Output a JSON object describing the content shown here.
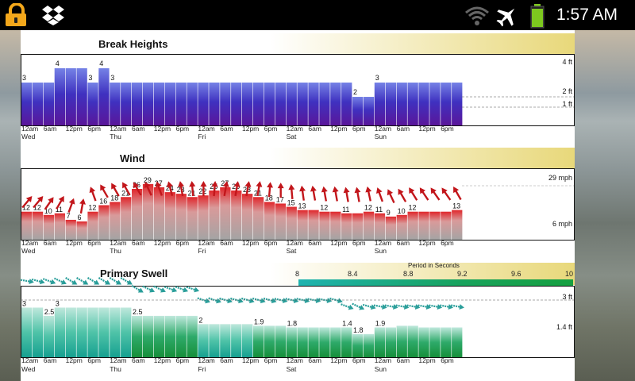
{
  "status_bar": {
    "time": "1:57 AM",
    "icons": [
      "lock-icon",
      "dropbox-icon",
      "wifi-icon",
      "airplane-icon",
      "battery-icon"
    ],
    "colors": {
      "background": "#000000",
      "lock": "#f3a71b",
      "battery": "#7dc81f"
    }
  },
  "sections": {
    "break_heights": {
      "title": "Break Heights"
    },
    "wind": {
      "title": "Wind"
    },
    "primary_swell": {
      "title": "Primary Swell"
    }
  },
  "time_axis": {
    "hour_labels": [
      "12am",
      "6am",
      "12pm",
      "6pm",
      "12am",
      "6am",
      "12pm",
      "6pm",
      "12am",
      "6am",
      "12pm",
      "6pm",
      "12am",
      "6am",
      "12pm",
      "6pm",
      "12am",
      "6am",
      "12pm",
      "6pm"
    ],
    "day_labels": [
      "Wed",
      "Thu",
      "Fri",
      "Sat",
      "Sun"
    ]
  },
  "period_legend": {
    "title": "Period in Seconds",
    "values": [
      "8",
      "8.4",
      "8.8",
      "9.2",
      "9.6",
      "10"
    ]
  },
  "colors": {
    "title_gradient_left": "#ffffff",
    "title_gradient_right": "#e8d87a",
    "break_bar_top": "#7582e6",
    "break_bar_bottom": "#5a169a",
    "wind_bar_top": "#e0262b",
    "wind_bar_bottom": "#a4a4a4",
    "wind_arrow": "#c2161b",
    "swell_bar_top": "#bfe8dc",
    "swell_bar_bottom": "#16a090",
    "swell_arrow": "#2a9e9a"
  },
  "chart_data": [
    {
      "type": "bar",
      "title": "Break Heights",
      "ylabel": "ft",
      "ytick_labels": [
        "4 ft",
        "2 ft",
        "1 ft"
      ],
      "ylim": [
        0,
        4
      ],
      "values": [
        3,
        3,
        3,
        4,
        4,
        4,
        3,
        4,
        3,
        3,
        3,
        3,
        3,
        3,
        3,
        3,
        3,
        3,
        3,
        3,
        3,
        3,
        3,
        3,
        3,
        3,
        3,
        3,
        3,
        3,
        2,
        2,
        3,
        3,
        3,
        3,
        3,
        3,
        3,
        3,
        3,
        3
      ],
      "data_labels": [
        {
          "index": 0,
          "text": "3"
        },
        {
          "index": 3,
          "text": "4"
        },
        {
          "index": 6,
          "text": "3"
        },
        {
          "index": 7,
          "text": "4"
        },
        {
          "index": 8,
          "text": "3"
        },
        {
          "index": 30,
          "text": "2"
        },
        {
          "index": 32,
          "text": "3"
        }
      ]
    },
    {
      "type": "bar",
      "title": "Wind",
      "ylabel": "mph",
      "ytick_labels": [
        "29 mph",
        "6 mph"
      ],
      "ylim": [
        0,
        32
      ],
      "values": [
        12,
        12,
        10,
        11,
        7,
        6,
        12,
        16,
        18,
        21,
        26,
        29,
        27,
        24,
        23,
        21,
        22,
        25,
        27,
        25,
        23,
        21,
        18,
        17,
        15,
        13,
        13,
        12,
        12,
        11,
        11,
        12,
        11,
        9,
        10,
        12,
        12,
        12,
        12,
        13,
        12
      ],
      "data_labels": [
        "12",
        "12",
        "10",
        "11",
        "7",
        "6",
        "12",
        "16",
        "18",
        "21",
        "26",
        "29",
        "27",
        "24",
        "23",
        "21",
        "22",
        "25",
        "27",
        "25",
        "23",
        "21",
        "18",
        "17",
        "15",
        "13",
        "",
        "12",
        "",
        "11",
        "",
        "12",
        "11",
        "9",
        "10",
        "12",
        "",
        "",
        "",
        "13",
        "12"
      ],
      "arrow_angles_deg": [
        220,
        220,
        215,
        210,
        200,
        190,
        160,
        150,
        150,
        150,
        150,
        155,
        160,
        165,
        170,
        175,
        180,
        185,
        190,
        190,
        190,
        190,
        185,
        180,
        175,
        172,
        170,
        170,
        170,
        170,
        170,
        168,
        160,
        155,
        150,
        148,
        146,
        145,
        145,
        150,
        155
      ]
    },
    {
      "type": "bar",
      "title": "Primary Swell",
      "ylabel": "ft",
      "ytick_labels": [
        "3 ft",
        "1.4 ft"
      ],
      "ylim": [
        0,
        3.6
      ],
      "values": [
        3,
        3,
        2.5,
        3,
        3,
        3,
        3,
        3,
        3,
        3,
        2.5,
        2.5,
        2.5,
        2.5,
        2.5,
        2.5,
        2,
        2,
        2,
        2,
        2,
        1.9,
        1.9,
        1.9,
        1.8,
        1.8,
        1.8,
        1.8,
        1.8,
        1.8,
        1.4,
        1.4,
        1.8,
        1.8,
        1.9,
        1.9,
        1.8,
        1.8,
        1.8,
        1.8,
        1.8
      ],
      "data_labels": [
        {
          "index": 0,
          "text": "3"
        },
        {
          "index": 2,
          "text": "2.5"
        },
        {
          "index": 3,
          "text": "3"
        },
        {
          "index": 10,
          "text": "2.5"
        },
        {
          "index": 16,
          "text": "2"
        },
        {
          "index": 21,
          "text": "1.9"
        },
        {
          "index": 24,
          "text": "1.8"
        },
        {
          "index": 29,
          "text": "1.4"
        },
        {
          "index": 30,
          "text": "1.8"
        },
        {
          "index": 32,
          "text": "1.9"
        }
      ],
      "arrow_angles_deg": [
        10,
        15,
        20,
        25,
        30,
        30,
        30,
        30,
        30,
        30,
        30,
        25,
        25,
        20,
        20,
        18,
        18,
        18,
        15,
        15,
        15,
        15,
        15,
        12,
        12,
        12,
        10,
        10,
        15,
        20,
        25,
        15,
        10,
        10,
        10,
        10,
        10,
        10,
        10,
        10,
        10
      ]
    }
  ]
}
